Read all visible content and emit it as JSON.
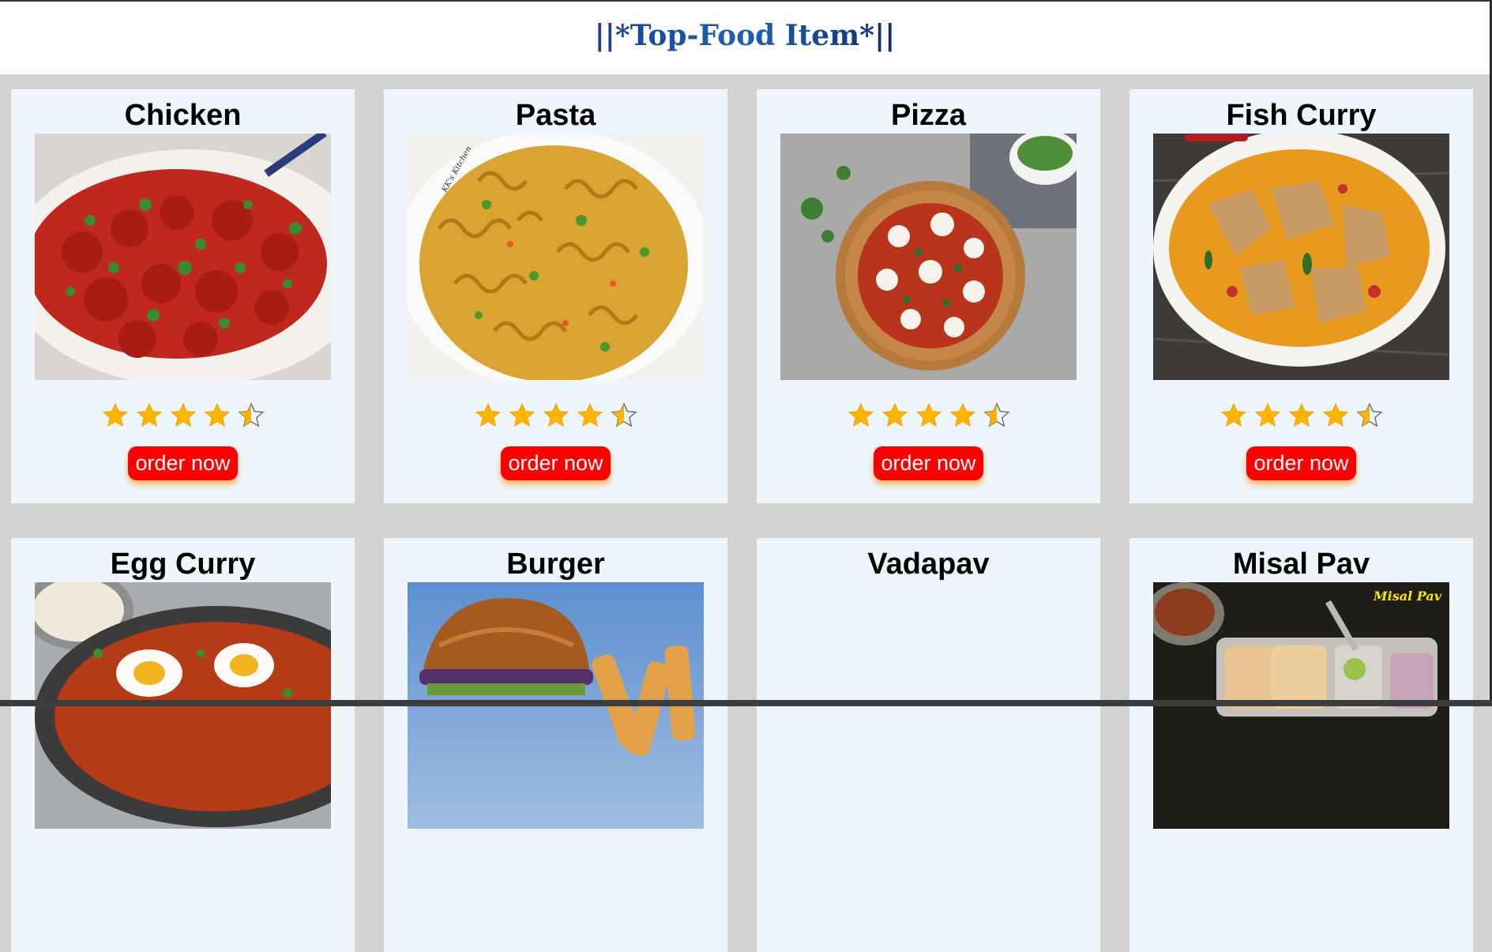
{
  "header": {
    "title": "||*Top-Food Item*||"
  },
  "colors": {
    "background": "#d3d3d3",
    "card": "#eef6fc",
    "button": "#ff0000",
    "star": "#ffb400"
  },
  "rating": {
    "value": 4.5,
    "max": 5
  },
  "items": [
    {
      "name": "Chicken",
      "image": "chicken-dish",
      "button": "order now"
    },
    {
      "name": "Pasta",
      "image": "pasta-dish",
      "button": "order now"
    },
    {
      "name": "Pizza",
      "image": "pizza-dish",
      "button": "order now"
    },
    {
      "name": "Fish Curry",
      "image": "fish-curry-dish",
      "button": "order now"
    },
    {
      "name": "Egg Curry",
      "image": "egg-curry-dish"
    },
    {
      "name": "Burger",
      "image": "burger-dish"
    },
    {
      "name": "Vadapav",
      "image": ""
    },
    {
      "name": "Misal Pav",
      "image": "misal-pav-dish",
      "image_text": "Misal Pav"
    }
  ],
  "watermarks": {
    "pasta": "KK's Kitchen"
  }
}
